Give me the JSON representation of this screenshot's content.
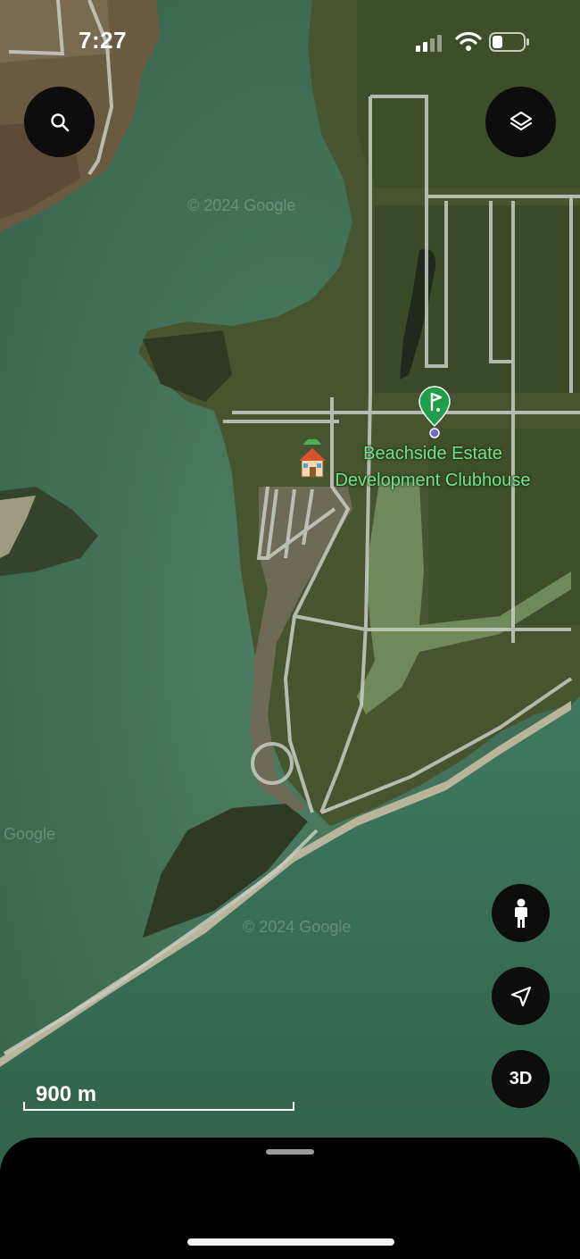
{
  "status_bar": {
    "time": "7:27"
  },
  "map": {
    "place_name_line1": "Beachside Estate",
    "place_name_line2": "Development Clubhouse",
    "scale_label": "900 m",
    "watermark": "© 2024 Google",
    "watermark_short": "Google",
    "pins": [
      {
        "icon": "golf-pin-icon",
        "color": "#1e9e4a"
      },
      {
        "icon": "house-icon",
        "color": "#e07b3a"
      }
    ]
  },
  "controls": {
    "search_icon": "search-icon",
    "layers_icon": "layers-icon",
    "street_view_icon": "pegman-icon",
    "navigation_icon": "navigation-arrow-icon",
    "three_d_label": "3D"
  },
  "colors": {
    "water": "#3f6e55",
    "land": "#4a5a32",
    "road": "#c9cdc4",
    "button_bg": "#0d0d0d",
    "label": "#78e08a"
  }
}
